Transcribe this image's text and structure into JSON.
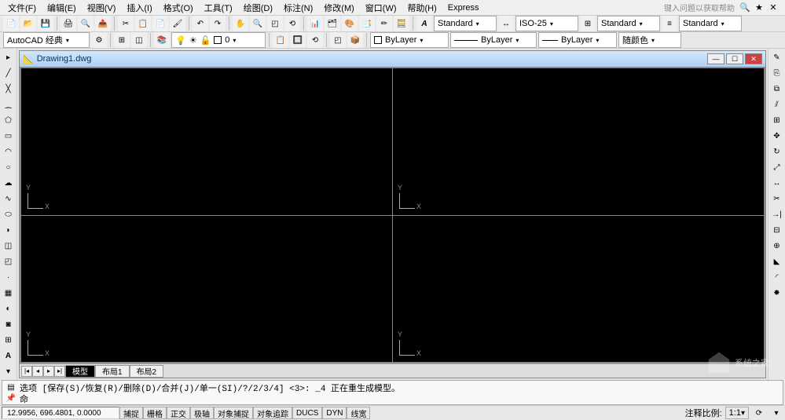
{
  "menubar": {
    "items": [
      "文件(F)",
      "编辑(E)",
      "视图(V)",
      "插入(I)",
      "格式(O)",
      "工具(T)",
      "绘图(D)",
      "标注(N)",
      "修改(M)",
      "窗口(W)",
      "帮助(H)",
      "Express"
    ],
    "help_hint": "键入问题以获取帮助"
  },
  "row1": {
    "text_style": "Standard",
    "dim_style": "ISO-25",
    "table_style": "Standard",
    "ml_style": "Standard"
  },
  "row2": {
    "workspace": "AutoCAD 经典",
    "layer_display": "0",
    "color": "ByLayer",
    "linetype": "ByLayer",
    "lineweight": "ByLayer",
    "plot_style": "随颜色"
  },
  "drawing": {
    "title": "Drawing1.dwg",
    "ucs_x": "X",
    "ucs_y": "Y",
    "tabs": [
      "模型",
      "布局1",
      "布局2"
    ]
  },
  "command": {
    "history": "选项 [保存(S)/恢复(R)/删除(D)/合并(J)/单一(SI)/?/2/3/4] <3>: _4 正在重生成模型。",
    "prompt": "命"
  },
  "status": {
    "coords": "12.9956, 696.4801, 0.0000",
    "toggles": [
      "捕捉",
      "栅格",
      "正交",
      "极轴",
      "对象捕捉",
      "对象追踪",
      "DUCS",
      "DYN",
      "线宽"
    ],
    "anno_label": "注释比例:",
    "anno_scale": "1:1"
  },
  "watermark": "系统之家",
  "left_tools": [
    "line",
    "xline",
    "pline",
    "polygon",
    "rect",
    "arc",
    "circle",
    "revcloud",
    "spline",
    "ellipse",
    "earc",
    "block",
    "point",
    "hatch",
    "grad",
    "region",
    "table",
    "mtext"
  ],
  "right_tools": [
    "erase",
    "copy",
    "mirror",
    "offset",
    "array",
    "move",
    "rotate",
    "scale",
    "stretch",
    "trim",
    "extend",
    "break",
    "join",
    "chamfer",
    "fillet",
    "explode"
  ]
}
